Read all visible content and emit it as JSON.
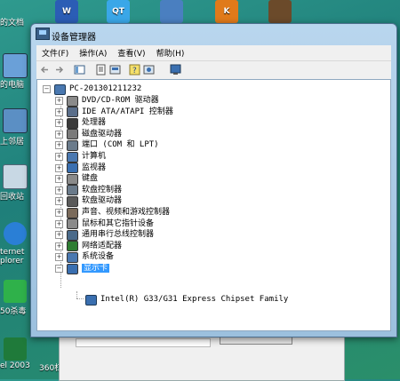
{
  "desktop": {
    "icons": [
      {
        "label": "的文档"
      },
      {
        "label": "的电脑"
      },
      {
        "label": "上邻居"
      },
      {
        "label": "回收站"
      },
      {
        "label": "ternet\nplorer"
      },
      {
        "label": "50杀毒"
      },
      {
        "label": "el 2003"
      },
      {
        "label": "360杠"
      }
    ],
    "top_labels": [
      "W",
      "QT",
      "",
      "K",
      ""
    ]
  },
  "window": {
    "title": "设备管理器",
    "menu": [
      "文件(F)",
      "操作(A)",
      "查看(V)",
      "帮助(H)"
    ],
    "tree": {
      "root": "PC-201301211232",
      "categories": [
        {
          "label": "DVD/CD-ROM 驱动器",
          "icon": "dvd-drive-icon",
          "color": "#8a8a8a"
        },
        {
          "label": "IDE ATA/ATAPI 控制器",
          "icon": "ide-controller-icon",
          "color": "#5a6e8a"
        },
        {
          "label": "处理器",
          "icon": "processor-icon",
          "color": "#3a3a3a"
        },
        {
          "label": "磁盘驱动器",
          "icon": "disk-drive-icon",
          "color": "#7a7a7a"
        },
        {
          "label": "端口 (COM 和 LPT)",
          "icon": "port-icon",
          "color": "#6b7b8b"
        },
        {
          "label": "计算机",
          "icon": "computer-icon",
          "color": "#4a78b0"
        },
        {
          "label": "监视器",
          "icon": "monitor-icon",
          "color": "#3a6fb0"
        },
        {
          "label": "键盘",
          "icon": "keyboard-icon",
          "color": "#8a8a8a"
        },
        {
          "label": "软盘控制器",
          "icon": "floppy-controller-icon",
          "color": "#6a7a8a"
        },
        {
          "label": "软盘驱动器",
          "icon": "floppy-drive-icon",
          "color": "#5a5a5a"
        },
        {
          "label": "声音、视频和游戏控制器",
          "icon": "sound-icon",
          "color": "#7a6a5a"
        },
        {
          "label": "鼠标和其它指针设备",
          "icon": "mouse-icon",
          "color": "#8a8a8a"
        },
        {
          "label": "通用串行总线控制器",
          "icon": "usb-icon",
          "color": "#4a6a8a"
        },
        {
          "label": "网络适配器",
          "icon": "network-adapter-icon",
          "color": "#2e7d32"
        },
        {
          "label": "系统设备",
          "icon": "system-device-icon",
          "color": "#4a78b0"
        },
        {
          "label": "显示卡",
          "icon": "display-adapter-icon",
          "color": "#3a6fb0",
          "expanded": true,
          "selected": true
        }
      ],
      "child": "Intel(R) G33/G31 Express Chipset Family"
    }
  },
  "colors": {
    "selection": "#3399ff",
    "window_frame": "#b9d6ee",
    "desktop": "#2a8f7e"
  }
}
